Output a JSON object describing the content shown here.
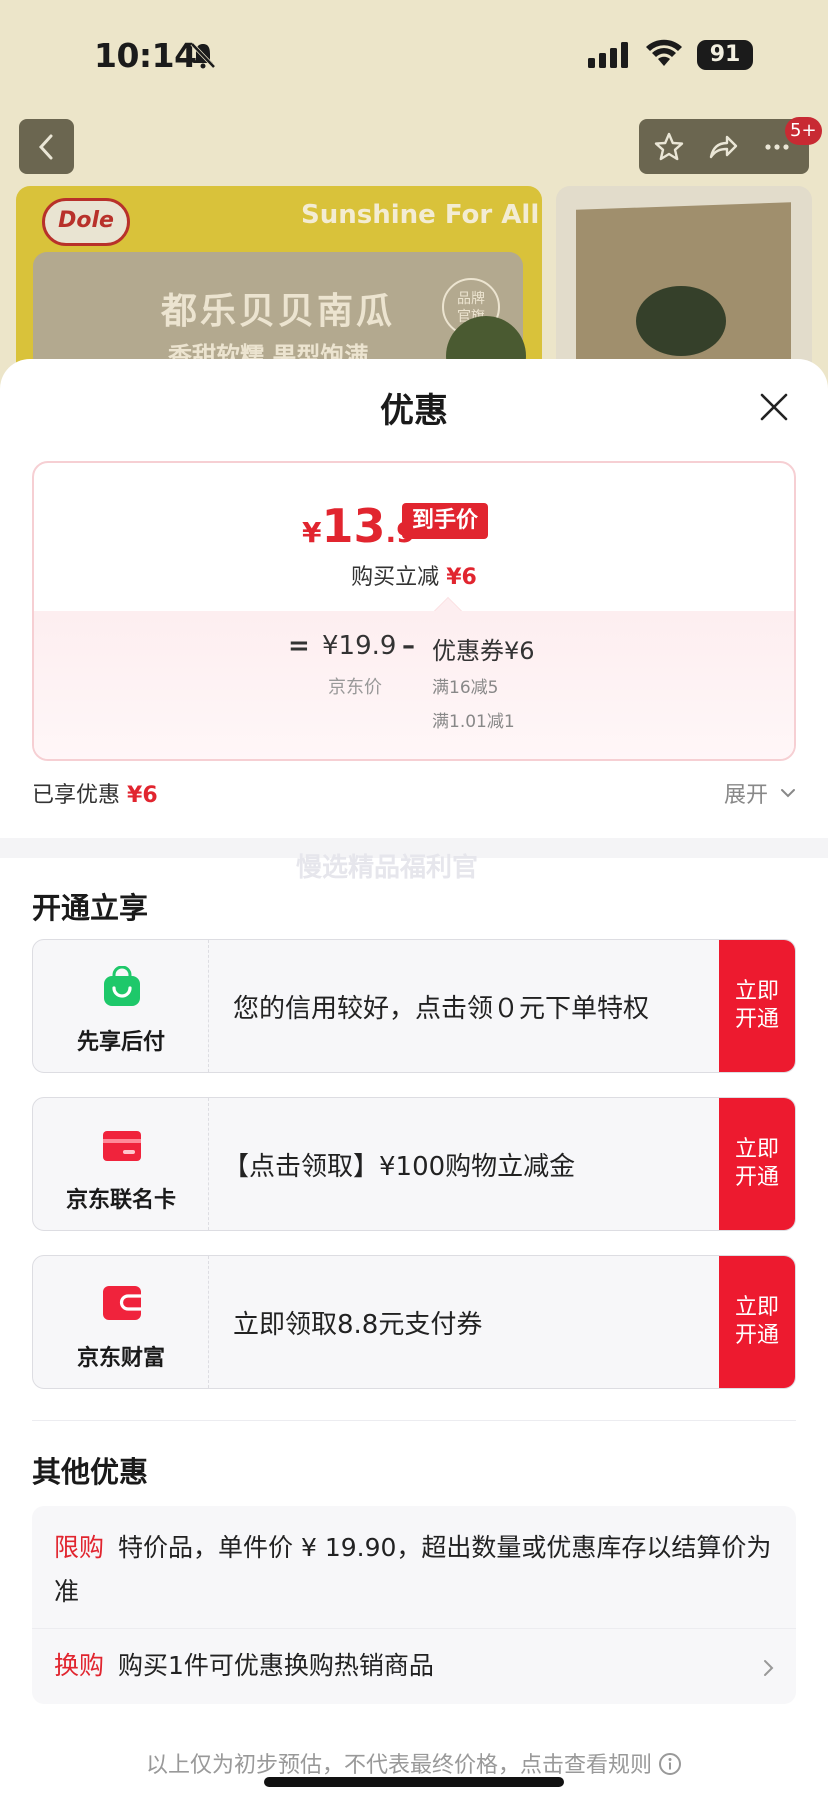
{
  "status_bar": {
    "time": "10:14",
    "battery": "91"
  },
  "nav": {
    "badge": "5+"
  },
  "banner": {
    "brand": "Dole",
    "slogan": "Sunshine For All",
    "title": "都乐贝贝南瓜",
    "subtitle": "香甜软糯 果型饱满",
    "seal": "品牌\n官旗"
  },
  "sheet": {
    "title": "优惠",
    "price": {
      "currency": "¥",
      "integer": "13",
      "decimal": ".9",
      "tag": "到手价",
      "direct_cut_label": "购买立减",
      "direct_cut_value": "¥6",
      "equals": "=",
      "jd_price": "¥19.9",
      "jd_label": "京东价",
      "minus": "–",
      "coupon": "优惠券¥6",
      "coupon_rules": [
        "满16减5",
        "满1.01减1"
      ]
    },
    "enjoyed_label": "已享优惠",
    "enjoyed_value": "¥6",
    "expand_label": "展开",
    "watermark": "慢选精品福利官"
  },
  "open_section": {
    "title": "开通立享",
    "offers": [
      {
        "name": "先享后付",
        "icon": "shopping-bag-icon",
        "desc": "您的信用较好，点击领０元下单特权",
        "button": "立即\n开通"
      },
      {
        "name": "京东联名卡",
        "icon": "credit-card-icon",
        "desc": "【点击领取】¥100购物立减金",
        "button": "立即\n开通"
      },
      {
        "name": "京东财富",
        "icon": "wallet-icon",
        "desc": "立即领取8.8元支付券",
        "button": "立即\n开通"
      }
    ]
  },
  "other_section": {
    "title": "其他优惠",
    "rows": [
      {
        "tag": "限购",
        "text": "特价品，单件价 ¥ 19.90，超出数量或优惠库存以结算价为准"
      },
      {
        "tag": "换购",
        "text": "购买1件可优惠换购热销商品"
      }
    ]
  },
  "footer": {
    "note": "以上仅为初步预估，不代表最终价格，点击查看规则"
  },
  "colors": {
    "accent": "#e1252f",
    "button_red": "#ed1a2f",
    "green": "#1ec86a"
  }
}
